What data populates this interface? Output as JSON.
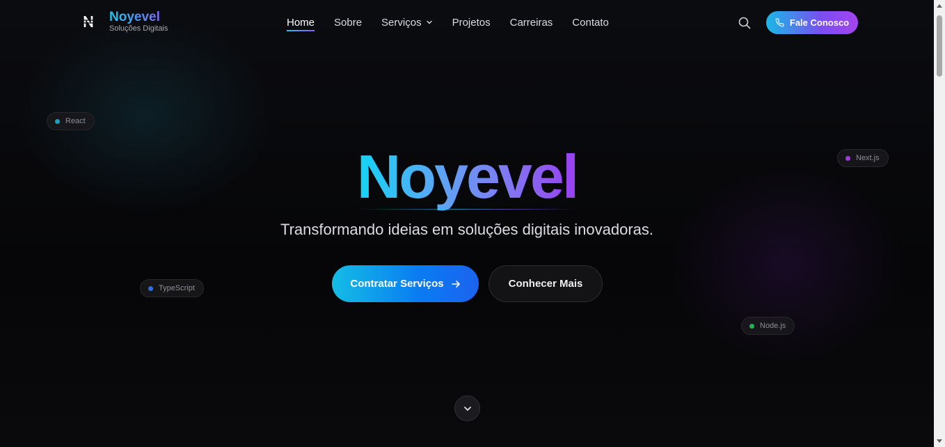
{
  "brand": {
    "name": "Noyevel",
    "tagline": "Soluções Digitais",
    "icon": "n-logo-icon"
  },
  "nav": {
    "items": [
      {
        "label": "Home",
        "active": true
      },
      {
        "label": "Sobre"
      },
      {
        "label": "Serviços",
        "dropdown": true
      },
      {
        "label": "Projetos"
      },
      {
        "label": "Carreiras"
      },
      {
        "label": "Contato"
      }
    ],
    "search_icon": "search-icon",
    "cta_label": "Fale Conosco",
    "cta_icon": "phone-icon"
  },
  "tags": {
    "react": {
      "label": "React",
      "color": "#1aa3b8"
    },
    "typescript": {
      "label": "TypeScript",
      "color": "#2f6fe0"
    },
    "nextjs": {
      "label": "Next.js",
      "color": "#9b3fd6"
    },
    "nodejs": {
      "label": "Node.js",
      "color": "#1fb355"
    }
  },
  "hero": {
    "title": "Noyevel",
    "subtitle": "Transformando ideias em soluções digitais inovadoras.",
    "primary_button": "Contratar Serviços",
    "secondary_button": "Conhecer Mais"
  },
  "colors": {
    "accent_cyan": "#22c0ee",
    "accent_purple": "#8b5cf6",
    "background": "#070709"
  }
}
